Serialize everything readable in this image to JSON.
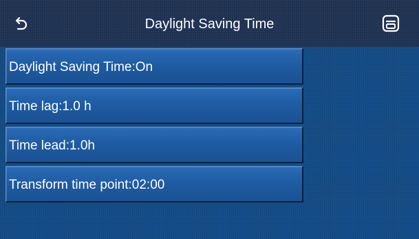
{
  "header": {
    "title": "Daylight Saving Time",
    "back_icon": "back-arrow-icon",
    "save_icon": "save-icon"
  },
  "menu": {
    "items": [
      {
        "label": "Daylight Saving Time:On"
      },
      {
        "label": "Time lag:1.0 h"
      },
      {
        "label": "Time lead:1.0h"
      },
      {
        "label": "Transform time point:02:00"
      }
    ]
  },
  "colors": {
    "background": "#16508c",
    "header": "#1d3050",
    "button": "#1f5ca3",
    "text": "#ffffff"
  }
}
